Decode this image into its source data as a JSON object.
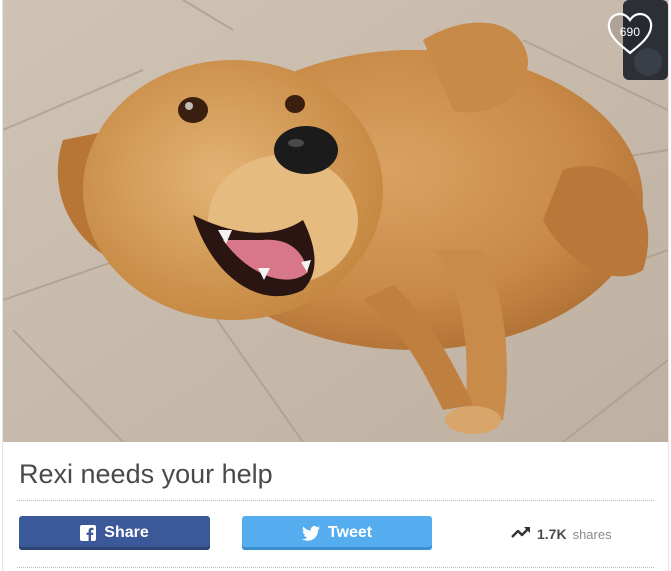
{
  "post": {
    "title": "Rexi needs your help",
    "likes": "690"
  },
  "actions": {
    "facebook_label": "Share",
    "twitter_label": "Tweet"
  },
  "stats": {
    "share_count": "1.7K",
    "share_word": "shares"
  },
  "icons": {
    "like": "heart-icon",
    "facebook": "facebook-icon",
    "twitter": "twitter-icon",
    "trending": "trending-up-icon"
  },
  "colors": {
    "facebook": "#3b5998",
    "twitter": "#55acee",
    "title_text": "#4a4a4a"
  }
}
